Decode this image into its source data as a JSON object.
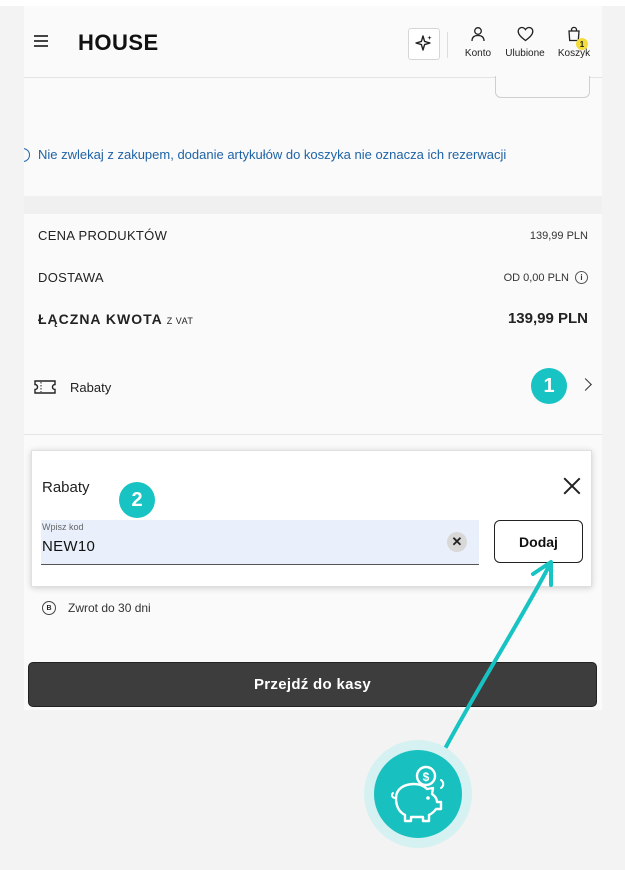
{
  "header": {
    "logo": "HOUSE",
    "account_label": "Konto",
    "favorites_label": "Ulubione",
    "cart_label": "Koszyk",
    "cart_count": "1"
  },
  "notice": {
    "text": "Nie zwlekaj z zakupem, dodanie artykułów do koszyka nie oznacza ich rezerwacji"
  },
  "summary": {
    "products_label": "CENA PRODUKTÓW",
    "products_value": "139,99 PLN",
    "delivery_label": "DOSTAWA",
    "delivery_value": "OD 0,00 PLN",
    "total_label": "ŁĄCZNA KWOTA",
    "total_suffix": "Z VAT",
    "total_value": "139,99 PLN"
  },
  "discounts": {
    "row_label": "Rabaty",
    "popup_title": "Rabaty",
    "code_placeholder": "Wpisz kod",
    "code_value": "NEW10",
    "add_button": "Dodaj"
  },
  "steps": {
    "step1": "1",
    "step2": "2"
  },
  "returns": {
    "text": "Zwrot do 30 dni"
  },
  "checkout": {
    "button": "Przejdź do kasy"
  },
  "colors": {
    "accent": "#17c3c3",
    "notice": "#1f63a6",
    "button_dark": "#3d3d3d",
    "input_bg": "#e9f0fc",
    "badge": "#f3dd3a"
  },
  "icons": [
    "menu-icon",
    "sparkle-icon",
    "user-icon",
    "heart-icon",
    "bag-icon",
    "info-icon",
    "ticket-icon",
    "chevron-right-icon",
    "close-icon",
    "clear-icon",
    "return-icon",
    "piggy-bank-icon"
  ]
}
